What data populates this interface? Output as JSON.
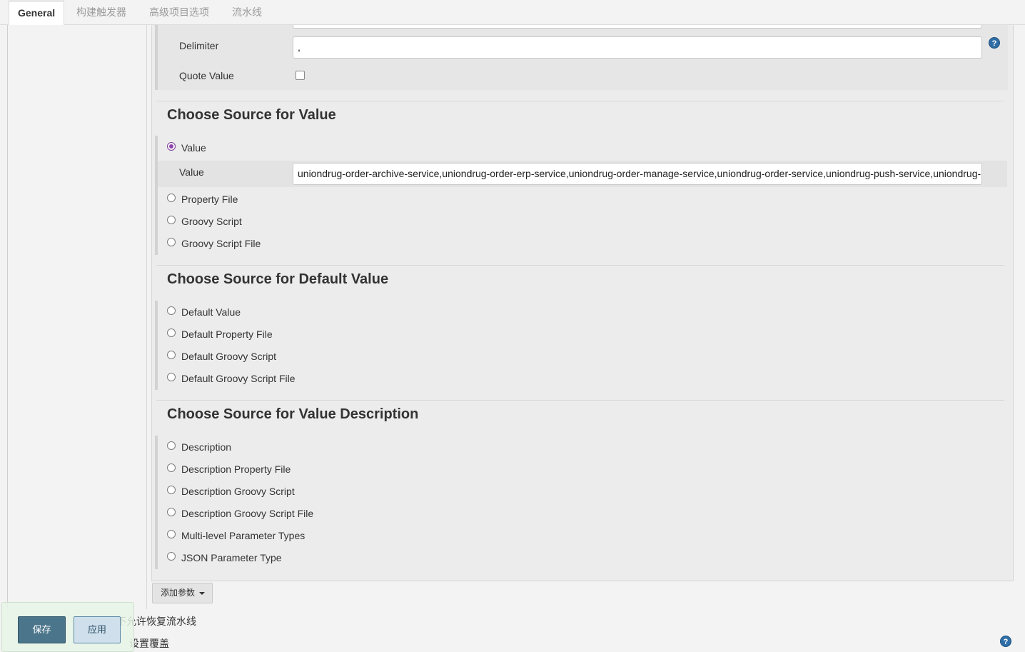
{
  "tabs": [
    {
      "label": "General",
      "active": true
    },
    {
      "label": "构建触发器",
      "active": false
    },
    {
      "label": "高级项目选项",
      "active": false
    },
    {
      "label": "流水线",
      "active": false
    }
  ],
  "top_fields": {
    "delimiter_label": "Delimiter",
    "delimiter_value": ",",
    "quote_value_label": "Quote Value",
    "quote_value_checked": false
  },
  "value_source": {
    "title": "Choose Source for Value",
    "options": [
      "Value",
      "Property File",
      "Groovy Script",
      "Groovy Script File"
    ],
    "selected": "Value",
    "value_field_label": "Value",
    "value_field_value": "uniondrug-order-archive-service,uniondrug-order-erp-service,uniondrug-order-manage-service,uniondrug-order-service,uniondrug-push-service,uniondrug-"
  },
  "default_value_source": {
    "title": "Choose Source for Default Value",
    "options": [
      "Default Value",
      "Default Property File",
      "Default Groovy Script",
      "Default Groovy Script File"
    ]
  },
  "description_source": {
    "title": "Choose Source for Value Description",
    "options": [
      "Description",
      "Description Property File",
      "Description Groovy Script",
      "Description Groovy Script File",
      "Multi-level Parameter Types",
      "JSON Parameter Type"
    ]
  },
  "add_param_label": "添加参数",
  "bottom": {
    "option1_label": "不允许恢复流水线",
    "option2_label": "设置覆盖",
    "save_label": "保存",
    "apply_label": "应用"
  },
  "colors": {
    "save_button": "#4b758b",
    "apply_button": "#cfe0ec",
    "help_icon": "#2f6ea6",
    "selected_radio": "#8e44ad"
  }
}
